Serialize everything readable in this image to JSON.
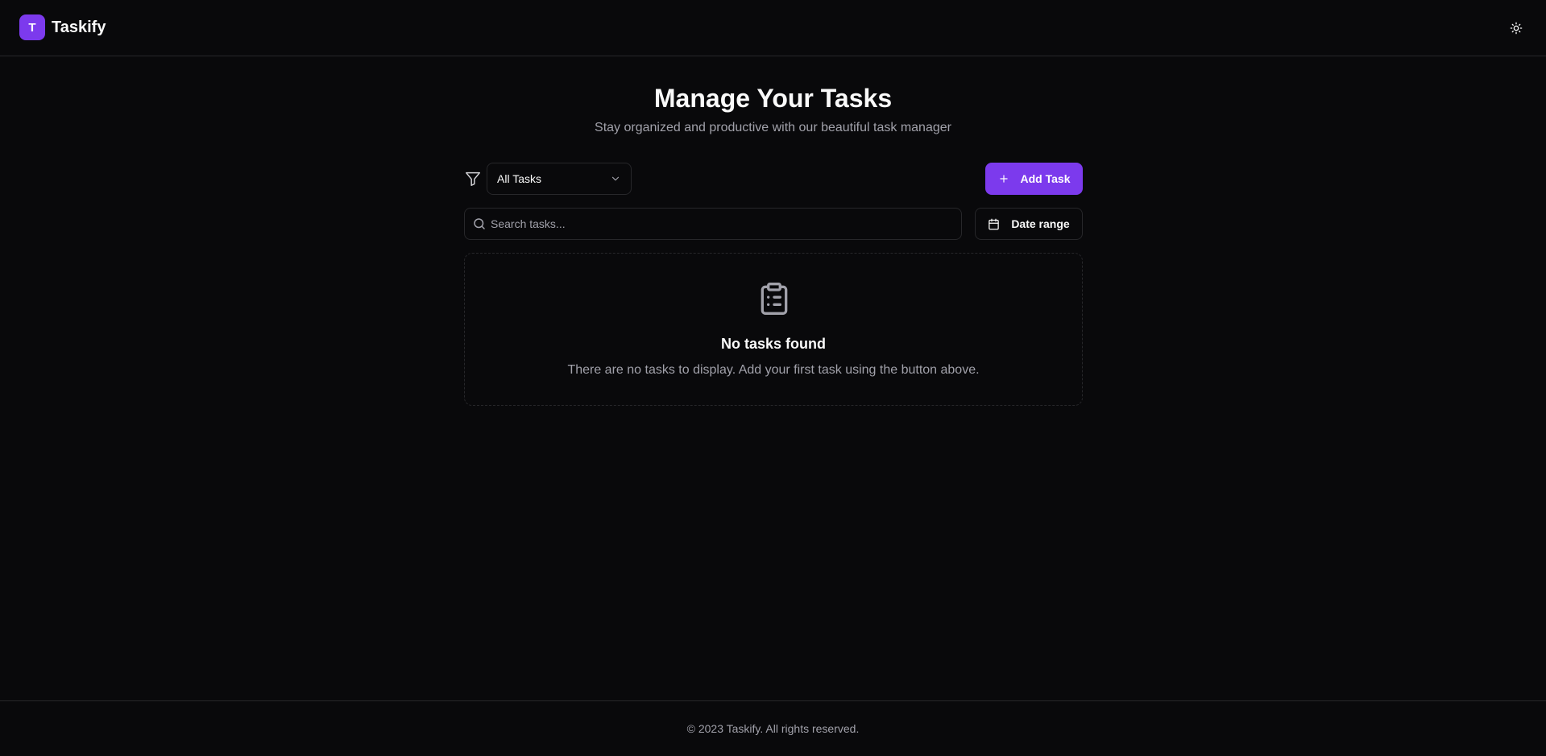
{
  "app": {
    "logo_letter": "T",
    "name": "Taskify"
  },
  "header": {
    "theme_toggle_icon": "sun-icon"
  },
  "hero": {
    "title": "Manage Your Tasks",
    "subtitle": "Stay organized and productive with our beautiful task manager"
  },
  "toolbar": {
    "filter_icon": "filter-icon",
    "filter_value": "All Tasks",
    "add_label": "Add Task"
  },
  "search": {
    "placeholder": "Search tasks...",
    "value": ""
  },
  "date_filter": {
    "label": "Date range"
  },
  "empty_state": {
    "icon": "clipboard-list-icon",
    "title": "No tasks found",
    "description": "There are no tasks to display. Add your first task using the button above."
  },
  "footer": {
    "text": "© 2023 Taskify. All rights reserved."
  },
  "colors": {
    "background": "#09090b",
    "accent": "#7c3aed",
    "border": "#27272a",
    "muted_text": "#a1a1aa",
    "text": "#fafafa"
  }
}
